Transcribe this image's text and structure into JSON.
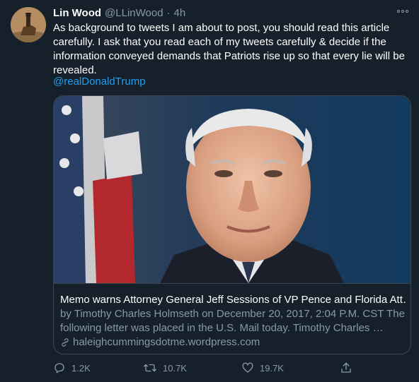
{
  "tweet": {
    "author_name": "Lin Wood",
    "author_handle": "@LLinWood",
    "separator": "·",
    "time": "4h",
    "text": "As background to tweets I am about to post, you should read this article carefully. I ask that you read each of my tweets carefully & decide if the information conveyed demands that Patriots rise up so that every lie will be revealed.",
    "mention": "@realDonaldTrump"
  },
  "card": {
    "title": "Memo warns Attorney General Jeff Sessions of VP Pence and Florida Att…",
    "description": "by Timothy Charles Holmseth on December 20, 2017, 2:04 P.M. CST The following letter was placed in the U.S. Mail today. Timothy Charles …",
    "domain": "haleighcummingsdotme.wordpress.com"
  },
  "actions": {
    "replies": "1.2K",
    "retweets": "10.7K",
    "likes": "19.7K"
  },
  "colors": {
    "background": "#15202b",
    "text_primary": "#ffffff",
    "text_secondary": "#8899a6",
    "link": "#1da1f2",
    "border": "#38444d"
  },
  "icons": {
    "more": "more-horizontal-icon",
    "reply": "reply-icon",
    "retweet": "retweet-icon",
    "like": "heart-icon",
    "share": "share-icon",
    "link": "link-icon"
  }
}
